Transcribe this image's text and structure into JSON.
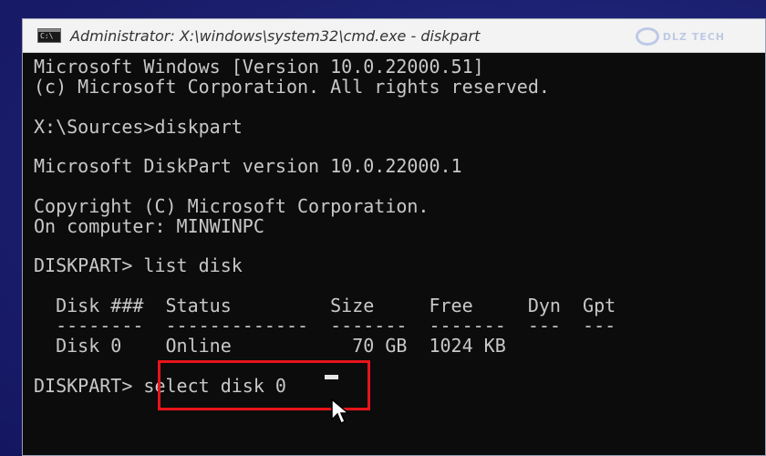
{
  "window": {
    "title": "Administrator: X:\\windows\\system32\\cmd.exe - diskpart",
    "icon": "cmd-icon",
    "icon_glyph": "C:\\"
  },
  "watermark": {
    "text": "DLZ TECH"
  },
  "console": {
    "lines": [
      "Microsoft Windows [Version 10.0.22000.51]",
      "(c) Microsoft Corporation. All rights reserved.",
      "",
      "X:\\Sources>diskpart",
      "",
      "Microsoft DiskPart version 10.0.22000.1",
      "",
      "Copyright (C) Microsoft Corporation.",
      "On computer: MINWINPC",
      "",
      "DISKPART> list disk",
      "",
      "  Disk ###  Status         Size     Free     Dyn  Gpt",
      "  --------  -------------  -------  -------  ---  ---",
      "  Disk 0    Online           70 GB  1024 KB",
      "",
      "DISKPART> select disk 0"
    ]
  },
  "colors": {
    "console_bg": "#0c0c0c",
    "console_text": "#c8c8c8",
    "highlight": "#e8141b",
    "desktop": "#1b1f6e"
  }
}
